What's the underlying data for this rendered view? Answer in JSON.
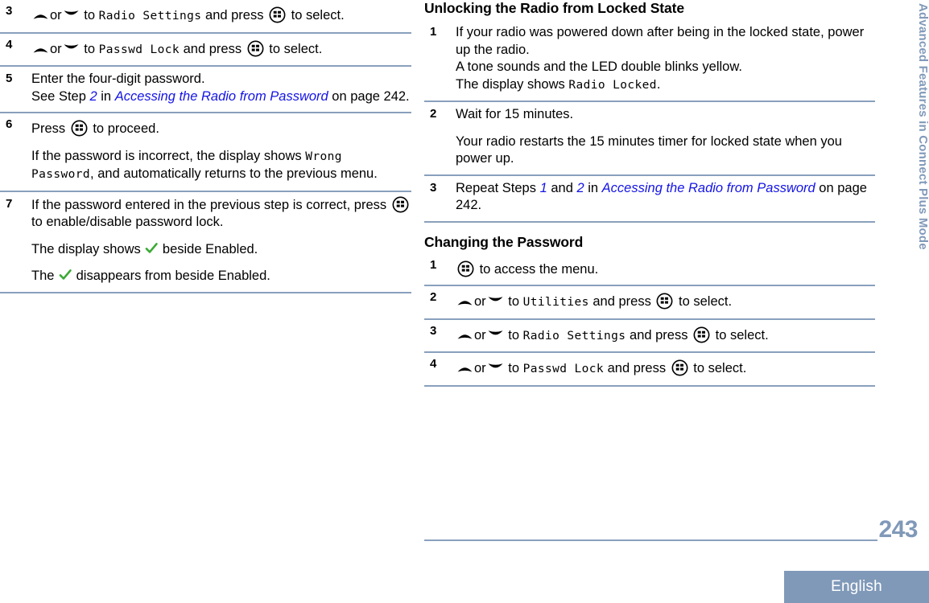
{
  "document": {
    "running_head": "Advanced Features in Connect Plus Mode",
    "page_number": "243",
    "language_badge": "English",
    "rule_color": "#89a0bd",
    "accent_color": "#8099b9",
    "link_color": "#1414e6",
    "check_color": "#3aaa35"
  },
  "left_column": {
    "steps": [
      {
        "number": "3",
        "lines": [
          {
            "pre": "",
            "icons": [
              "up-arrow",
              "or",
              "down-arrow"
            ],
            "mid": " to ",
            "mono": "Radio Settings",
            "post": " and press ",
            "icon2": "menu-button",
            "tail": " to select."
          }
        ]
      },
      {
        "number": "4",
        "lines": [
          {
            "pre": "",
            "icons": [
              "up-arrow",
              "or",
              "down-arrow"
            ],
            "mid": " to ",
            "mono": "Passwd Lock",
            "post": " and press ",
            "icon2": "menu-button",
            "tail": " to select."
          }
        ]
      },
      {
        "number": "5",
        "text_line1": "Enter the four-digit password.",
        "text_line2_a": "See Step ",
        "text_line2_step": "2",
        "text_line2_b": " in ",
        "text_line2_link": "Accessing the Radio from Password",
        "text_line2_c": " on page 242."
      },
      {
        "number": "6",
        "para1_a": "Press ",
        "para1_b": " to proceed.",
        "para2_a": "If the password is incorrect, the display shows ",
        "para2_mono": "Wrong Password",
        "para2_b": ", and automatically returns to the previous menu."
      },
      {
        "number": "7",
        "para1_a": "If the password entered in the previous step is correct, press ",
        "para1_b": " to enable/disable password lock.",
        "para2_a": "The display shows ",
        "para2_b": " beside Enabled.",
        "para3_a": "The ",
        "para3_b": " disappears from beside Enabled."
      }
    ]
  },
  "right_column": {
    "section1_heading": "Unlocking the Radio from Locked State",
    "section1_steps": [
      {
        "number": "1",
        "line1": "If your radio was powered down after being in the locked state, power up the radio.",
        "line2": "A tone sounds and the LED double blinks yellow.",
        "line3_a": "The display shows ",
        "line3_mono": "Radio Locked",
        "line3_b": "."
      },
      {
        "number": "2",
        "line1": "Wait for 15 minutes.",
        "line2": "Your radio restarts the 15 minutes timer for locked state when you power up."
      },
      {
        "number": "3",
        "line1_a": "Repeat Steps ",
        "line1_step1": "1",
        "line1_b": " and ",
        "line1_step2": "2",
        "line1_c": " in ",
        "line1_link": "Accessing the Radio from Password",
        "line1_d": " on page 242."
      }
    ],
    "section2_heading": "Changing the Password",
    "section2_steps": [
      {
        "number": "1",
        "tail": " to access the menu."
      },
      {
        "number": "2",
        "mid": " to ",
        "mono": "Utilities",
        "post": " and press ",
        "tail": " to select.",
        "or": "or"
      },
      {
        "number": "3",
        "mid": " to ",
        "mono": "Radio Settings",
        "post": " and press ",
        "tail": " to select.",
        "or": "or"
      },
      {
        "number": "4",
        "mid": " to ",
        "mono": "Passwd Lock",
        "post": " and press ",
        "tail": " to select.",
        "or": "or"
      }
    ]
  },
  "labels": {
    "or": "or"
  }
}
